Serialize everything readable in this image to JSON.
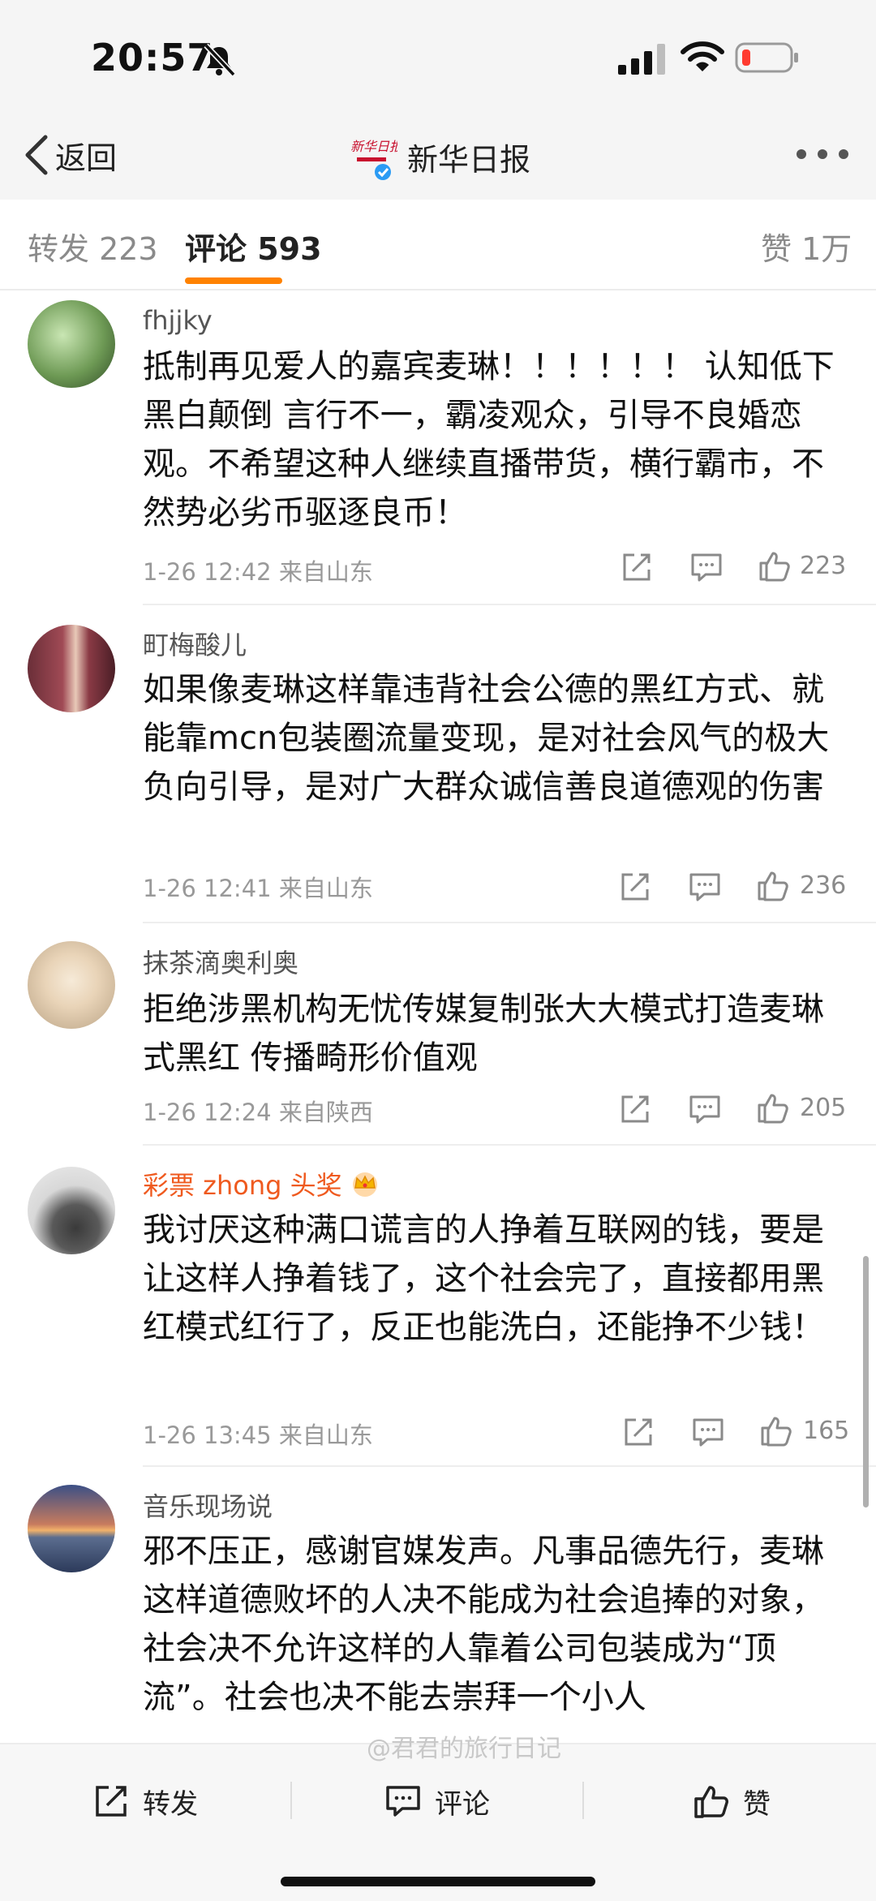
{
  "status_bar": {
    "time": "20:57"
  },
  "nav": {
    "back_label": "返回",
    "title": "新华日报",
    "logo_text": "新华日报"
  },
  "tabs": {
    "repost": "转发 223",
    "comment": "评论 593",
    "like": "赞 1万"
  },
  "comments": [
    {
      "user": "fhjjky",
      "text": "抵制再见爱人的嘉宾麦琳！！！！！！ 认知低下 黑白颠倒 言行不一，霸凌观众，引导不良婚恋观。不希望这种人继续直播带货，横行霸市，不然势必劣币驱逐良币！",
      "meta": "1-26 12:42  来自山东",
      "likes": "223"
    },
    {
      "user": "町梅酸儿",
      "text": "如果像麦琳这样靠违背社会公德的黑红方式、就能靠mcn包装圈流量变现，是对社会风气的极大负向引导，是对广大群众诚信善良道德观的伤害",
      "meta": "1-26 12:41  来自山东",
      "likes": "236"
    },
    {
      "user": "抹茶滴奥利奥",
      "text": "拒绝涉黑机构无忧传媒复制张大大模式打造麦琳式黑红 传播畸形价值观",
      "meta": "1-26 12:24  来自陕西",
      "likes": "205"
    },
    {
      "user": "彩票 zhong 头奖",
      "text": "我讨厌这种满口谎言的人挣着互联网的钱，要是让这样人挣着钱了，这个社会完了，直接都用黑红模式红行了，反正也能洗白，还能挣不少钱！",
      "meta": "1-26 13:45  来自山东",
      "likes": "165"
    },
    {
      "user": "音乐现场说",
      "text": "邪不压正，感谢官媒发声。凡事品德先行，麦琳这样道德败坏的人决不能成为社会追捧的对象，社会决不允许这样的人靠着公司包装成为“顶流”。社会也决不能去崇拜一个小人"
    }
  ],
  "bottom_bar": {
    "repost": "转发",
    "comment": "评论",
    "like": "赞"
  },
  "watermark": "@君君的旅行日记",
  "colors": {
    "accent": "#ff8200",
    "vip_name": "#ef5a1f",
    "meta": "#999999"
  }
}
